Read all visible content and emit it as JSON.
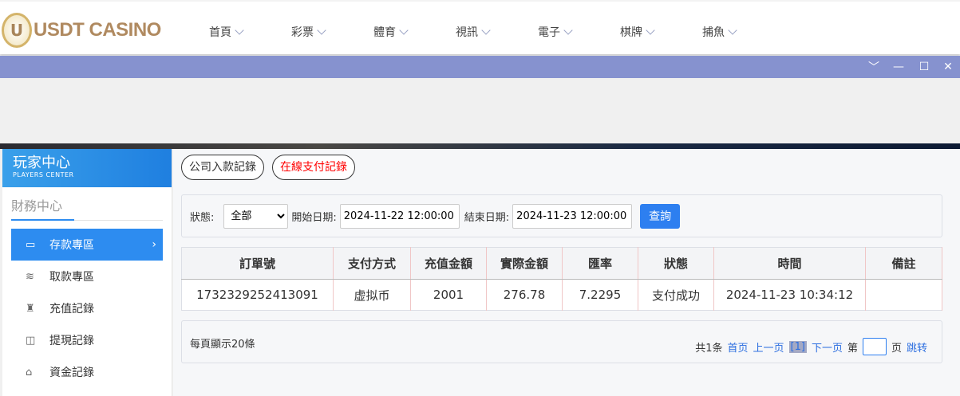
{
  "brand": {
    "logo_text": "USDT CASINO"
  },
  "nav": [
    "首頁",
    "彩票",
    "體育",
    "視訊",
    "電子",
    "棋牌",
    "捕魚"
  ],
  "window_controls": [
    "chevron-down",
    "minimize",
    "maximize",
    "close"
  ],
  "sidebar": {
    "title": "玩家中心",
    "subtitle": "PLAYERS CENTER",
    "section": "財務中心",
    "items": [
      {
        "label": "存款專區",
        "active": true
      },
      {
        "label": "取款專區"
      },
      {
        "label": "充值記錄"
      },
      {
        "label": "提現記錄"
      },
      {
        "label": "資金記錄"
      }
    ]
  },
  "tabs": {
    "company": "公司入款記錄",
    "online": "在線支付記錄"
  },
  "filter": {
    "status_label": "狀態:",
    "status_value": "全部",
    "start_label": "開始日期:",
    "start_value": "2024-11-22 12:00:00",
    "end_label": "結束日期:",
    "end_value": "2024-11-23 12:00:00",
    "query": "查詢"
  },
  "table": {
    "headers": [
      "訂單號",
      "支付方式",
      "充值金額",
      "實際金額",
      "匯率",
      "狀態",
      "時間",
      "備註"
    ],
    "rows": [
      [
        "1732329252413091",
        "虚拟币",
        "2001",
        "276.78",
        "7.2295",
        "支付成功",
        "2024-11-23 10:34:12",
        ""
      ]
    ]
  },
  "pager": {
    "per_page": "每頁顯示20條",
    "total": "共1条",
    "first": "首页",
    "prev": "上一页",
    "current": "[1]",
    "next": "下一页",
    "page_prefix": "第",
    "page_suffix": "页",
    "jump": "跳转"
  },
  "colors": {
    "accent": "#2d8cf0",
    "titlebar": "#8692cf",
    "online_tab": "#ff0000"
  }
}
